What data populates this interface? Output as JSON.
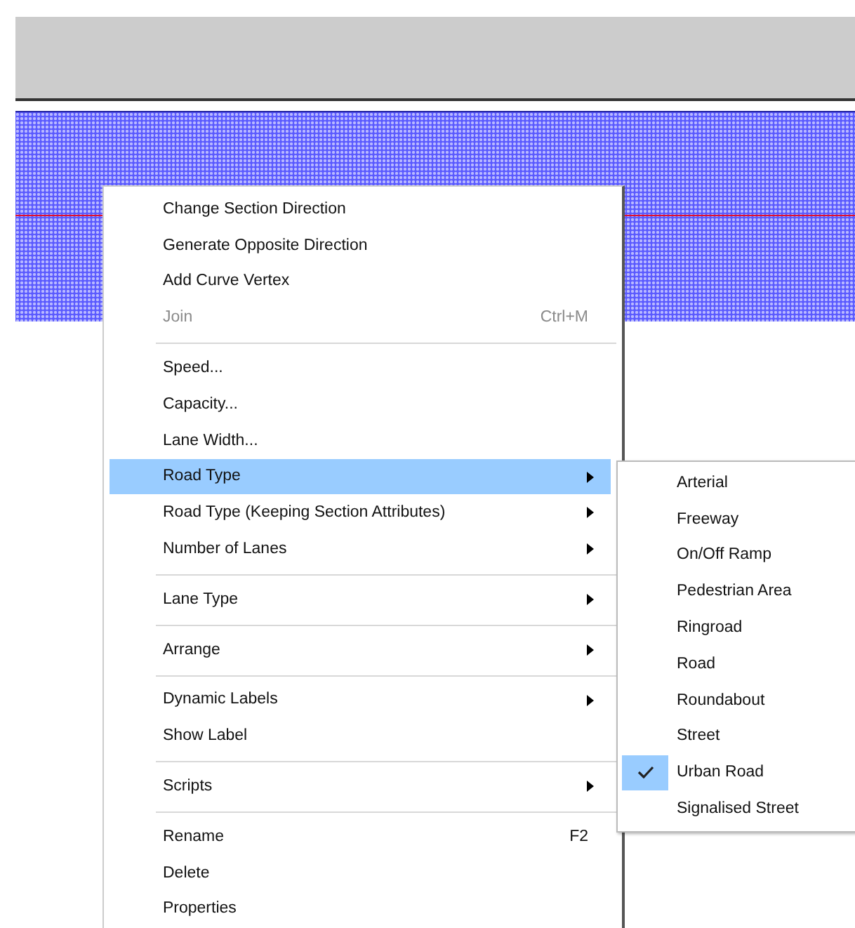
{
  "context_menu": {
    "items": [
      {
        "kind": "item",
        "label": "Change Section Direction",
        "selected": false,
        "disabled": false,
        "submenu": false
      },
      {
        "kind": "item",
        "label": "Generate Opposite Direction",
        "selected": false,
        "disabled": false,
        "submenu": false
      },
      {
        "kind": "item",
        "label": "Add Curve Vertex",
        "selected": false,
        "disabled": false,
        "submenu": false
      },
      {
        "kind": "item",
        "label": "Join",
        "shortcut": "Ctrl+M",
        "selected": false,
        "disabled": true,
        "submenu": false
      },
      {
        "kind": "separator"
      },
      {
        "kind": "item",
        "label": "Speed...",
        "selected": false,
        "disabled": false,
        "submenu": false
      },
      {
        "kind": "item",
        "label": "Capacity...",
        "selected": false,
        "disabled": false,
        "submenu": false
      },
      {
        "kind": "item",
        "label": "Lane Width...",
        "selected": false,
        "disabled": false,
        "submenu": false
      },
      {
        "kind": "item",
        "label": "Road Type",
        "selected": true,
        "disabled": false,
        "submenu": true
      },
      {
        "kind": "item",
        "label": "Road Type (Keeping Section Attributes)",
        "selected": false,
        "disabled": false,
        "submenu": true
      },
      {
        "kind": "item",
        "label": "Number of Lanes",
        "selected": false,
        "disabled": false,
        "submenu": true
      },
      {
        "kind": "separator"
      },
      {
        "kind": "item",
        "label": "Lane Type",
        "selected": false,
        "disabled": false,
        "submenu": true
      },
      {
        "kind": "separator"
      },
      {
        "kind": "item",
        "label": "Arrange",
        "selected": false,
        "disabled": false,
        "submenu": true
      },
      {
        "kind": "separator"
      },
      {
        "kind": "item",
        "label": "Dynamic Labels",
        "selected": false,
        "disabled": false,
        "submenu": true
      },
      {
        "kind": "item",
        "label": "Show Label",
        "selected": false,
        "disabled": false,
        "submenu": false
      },
      {
        "kind": "separator"
      },
      {
        "kind": "item",
        "label": "Scripts",
        "selected": false,
        "disabled": false,
        "submenu": true
      },
      {
        "kind": "separator"
      },
      {
        "kind": "item",
        "label": "Rename",
        "shortcut": "F2",
        "selected": false,
        "disabled": false,
        "submenu": false
      },
      {
        "kind": "item",
        "label": "Delete",
        "selected": false,
        "disabled": false,
        "submenu": false
      },
      {
        "kind": "item",
        "label": "Properties",
        "selected": false,
        "disabled": false,
        "submenu": false
      }
    ]
  },
  "submenu": {
    "items": [
      {
        "label": "Arterial",
        "checked": false
      },
      {
        "label": "Freeway",
        "checked": false
      },
      {
        "label": "On/Off Ramp",
        "checked": false
      },
      {
        "label": "Pedestrian Area",
        "checked": false
      },
      {
        "label": "Ringroad",
        "checked": false
      },
      {
        "label": "Road",
        "checked": false
      },
      {
        "label": "Roundabout",
        "checked": false
      },
      {
        "label": "Street",
        "checked": false
      },
      {
        "label": "Urban Road",
        "checked": true
      },
      {
        "label": "Signalised Street",
        "checked": false
      }
    ]
  }
}
